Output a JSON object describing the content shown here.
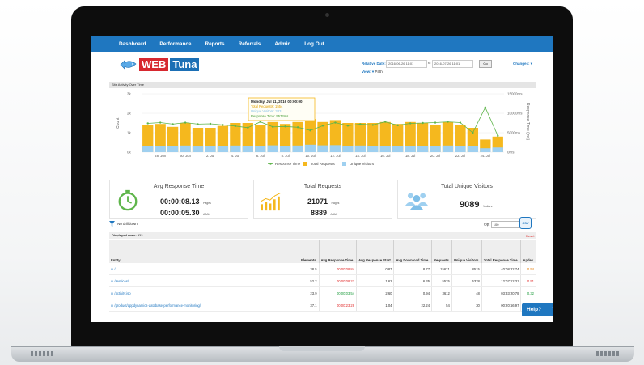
{
  "nav": [
    "Dashboard",
    "Performance",
    "Reports",
    "Referrals",
    "Admin",
    "Log Out"
  ],
  "logo": {
    "web": "WEB",
    "tuna": "Tuna"
  },
  "controls": {
    "relative_date_label": "Relative Date:",
    "date_from": "2016-06-26 11:01",
    "date_sep": "to",
    "date_to": "2016-07-26 11:01",
    "go_label": "Go",
    "changes_label": "Changes:",
    "view_label": "View:",
    "view_value": "Path"
  },
  "section_title": "Site Activity Over Time",
  "chart_data": {
    "type": "bar",
    "title": "Site Activity Over Time",
    "ylabel": "Count",
    "y2label": "Response Time (ms)",
    "ylim": [
      0,
      3000
    ],
    "y2lim": [
      0,
      15000
    ],
    "y_ticks": [
      "3k",
      "2k",
      "1k",
      "0k"
    ],
    "y2_ticks": [
      "15000ms",
      "10000ms",
      "5000ms",
      "0ms"
    ],
    "x_ticks": [
      "28. Jun",
      "30. Jun",
      "2. Jul",
      "4. Jul",
      "6. Jul",
      "8. Jul",
      "10. Jul",
      "12. Jul",
      "14. Jul",
      "16. Jul",
      "18. Jul",
      "20. Jul",
      "22. Jul",
      "24. Jul"
    ],
    "series": [
      {
        "name": "Total Requests",
        "values": [
          1400,
          1450,
          1300,
          1500,
          1250,
          1250,
          1350,
          1500,
          1500,
          1400,
          1550,
          1450,
          1550,
          1700,
          1550,
          1650,
          1500,
          1500,
          1500,
          1550,
          1450,
          1550,
          1500,
          1400,
          1550,
          1400,
          1250,
          650,
          800
        ]
      },
      {
        "name": "Unique Visitors",
        "values": [
          300,
          330,
          300,
          340,
          290,
          300,
          310,
          340,
          330,
          320,
          350,
          330,
          340,
          383,
          350,
          360,
          330,
          340,
          320,
          330,
          320,
          330,
          330,
          310,
          340,
          320,
          300,
          200,
          240
        ]
      },
      {
        "name": "Response Time",
        "values": [
          7400,
          7600,
          7200,
          7600,
          7200,
          7300,
          7000,
          6700,
          6300,
          7800,
          6500,
          6600,
          6400,
          5573,
          6800,
          7600,
          6800,
          7200,
          7000,
          7800,
          6900,
          7400,
          7500,
          7600,
          7800,
          7600,
          5000,
          11500,
          4200
        ]
      }
    ],
    "legend": [
      "Response Time",
      "Total Requests",
      "Unique Visitors"
    ],
    "tooltip": {
      "date": "Monday, Jul 11, 2016 00:00:00",
      "l1": "Total Requests: 1554",
      "l2": "Unique Visitors: 383",
      "l3": "Response Time: 5573ms"
    },
    "colors": {
      "requests": "#f5b81e",
      "visitors": "#9fd0f0",
      "response": "#5fb54b"
    }
  },
  "stats": {
    "avg_title": "Avg Response Time",
    "avg_page": "00:00:08.13",
    "avg_page_unit": "Pages",
    "avg_ajax": "00:00:05.30",
    "avg_ajax_unit": "AJAX",
    "req_title": "Total Requests",
    "req_pages": "21071",
    "req_pages_unit": "Pages",
    "req_ajax": "8889",
    "req_ajax_unit": "AJAX",
    "vis_title": "Total Unique Visitors",
    "vis_count": "9089",
    "vis_unit": "Visitors"
  },
  "drill": "No drilldown",
  "top_label": "Top:",
  "top_value": "100",
  "csv_label": "CSV",
  "displayed_rows": "Displayed rows: 212",
  "reset": "Reset",
  "table": {
    "headers": [
      "Entity",
      "Elements",
      "Avg Response Time",
      "Avg Response Start",
      "Avg Download Time",
      "Requests",
      "Unique Visitors",
      "Total Response Time",
      "Apdex"
    ],
    "rows": [
      [
        "/",
        "38.5",
        "00:00:08.84",
        "0.87",
        "8.77",
        "15621",
        "8515",
        "40:08:22.74",
        "0.54"
      ],
      [
        "/services/",
        "52.2",
        "00:00:08.27",
        "1.62",
        "6.35",
        "5525",
        "5328",
        "12:07:12.31",
        "0.51"
      ],
      [
        "/activity.jsp",
        "23.9",
        "00:00:03.54",
        "2.60",
        "0.94",
        "3612",
        "48",
        "03:33:20.78",
        "0.32"
      ],
      [
        "/product/appdynamics-database-performance-monitoring/",
        "37.1",
        "00:00:23.28",
        "1.04",
        "22.24",
        "54",
        "30",
        "00:20:56.97",
        ""
      ]
    ]
  },
  "help": "Help?"
}
